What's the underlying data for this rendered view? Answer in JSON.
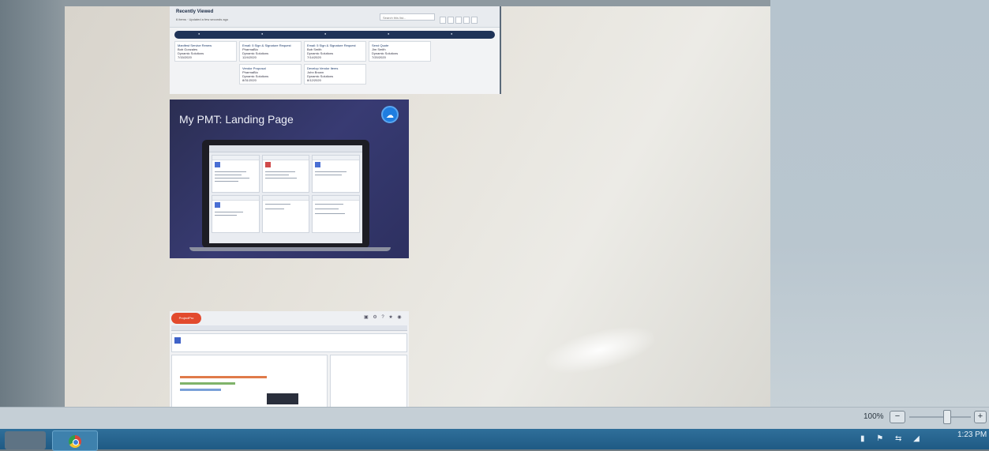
{
  "viewer": {
    "zoom_label": "100%",
    "zoom_out": "−",
    "zoom_in": "+"
  },
  "slide1": {
    "title": "Recently Viewed",
    "subtitle": "6 items · Updated a few seconds ago",
    "search_placeholder": "Search this list...",
    "columns": [
      {
        "cards": [
          {
            "title": "Manifest Service Renew",
            "lines": [
              "Bob Gonzales",
              "Dynamic Solutions",
              "7/15/2020"
            ]
          }
        ]
      },
      {
        "cards": [
          {
            "title": "Email: 5 Sign & Signature Request",
            "lines": [
              "PharmaBio",
              "Dynamic Solutions",
              "12/4/2020"
            ]
          },
          {
            "title": "Vendor Proposal",
            "lines": [
              "PharmaBio",
              "Dynamic Solutions",
              "8/31/2020"
            ]
          }
        ]
      },
      {
        "cards": [
          {
            "title": "Email: 5 Sign & Signature Request",
            "lines": [
              "Bob Smith",
              "Dynamic Solutions",
              "7/14/2020"
            ]
          },
          {
            "title": "Develop Vendor Items",
            "lines": [
              "John Brown",
              "Dynamic Solutions",
              "8/12/2020"
            ]
          }
        ]
      },
      {
        "cards": [
          {
            "title": "Send Quote",
            "lines": [
              "Jim Smith",
              "Dynamic Solutions",
              "7/20/2020"
            ]
          }
        ]
      }
    ]
  },
  "slide2": {
    "title": "My PMT: Landing Page",
    "badge_icon": "cloud-icon"
  },
  "slide3": {
    "logo_text": "ProjectPro"
  },
  "taskbar": {
    "clock_time": "1:23 PM"
  }
}
